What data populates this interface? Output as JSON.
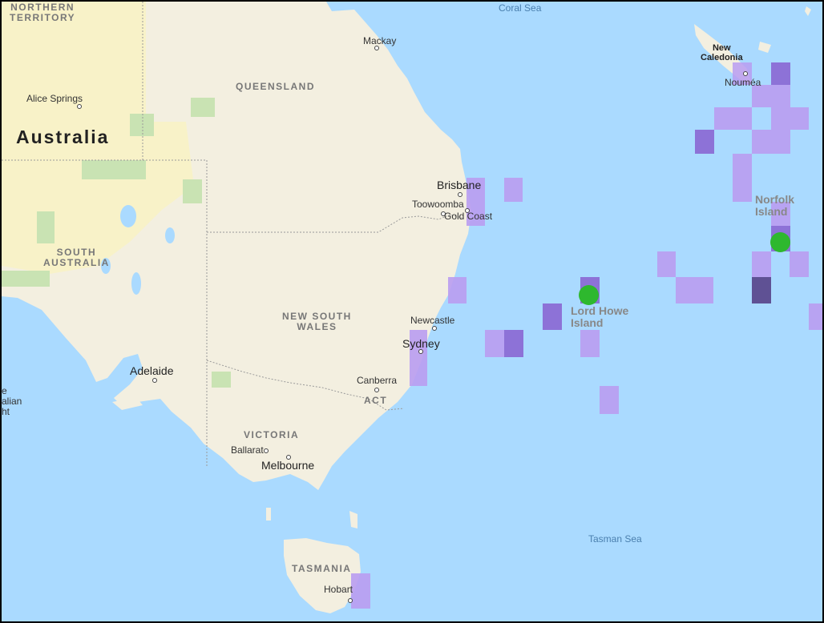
{
  "map": {
    "country_label": "Australia",
    "state_labels": {
      "northern_territory": [
        "NORTHERN",
        "TERRITORY"
      ],
      "queensland": "QUEENSLAND",
      "south_australia": [
        "SOUTH",
        "AUSTRALIA"
      ],
      "new_south_wales": [
        "NEW SOUTH",
        "WALES"
      ],
      "victoria": "VICTORIA",
      "act": "ACT",
      "tasmania": "TASMANIA"
    },
    "city_labels": {
      "alice_springs": "Alice Springs",
      "mackay": "Mackay",
      "brisbane": "Brisbane",
      "toowoomba": "Toowoomba",
      "gold_coast": "Gold Coast",
      "newcastle": "Newcastle",
      "sydney": "Sydney",
      "canberra": "Canberra",
      "adelaide": "Adelaide",
      "ballarat": "Ballarat",
      "melbourne": "Melbourne",
      "hobart": "Hobart",
      "noumea": "Nouméa"
    },
    "sea_labels": {
      "coral_sea": "Coral Sea",
      "tasman_sea": "Tasman Sea"
    },
    "island_labels": {
      "lord_howe": [
        "Lord Howe",
        "Island"
      ],
      "norfolk": [
        "Norfolk",
        "Island"
      ],
      "new_caledonia": [
        "New",
        "Caledonia"
      ]
    },
    "edge_fragment": [
      "e",
      "alian",
      "ht"
    ],
    "colors": {
      "ocean": "#aadaff",
      "land": "#f3efe0",
      "desert": "#f8f2c8",
      "park": "#c9e3b3",
      "cell_light": "#b99cf1",
      "cell_mid": "#8a66d3",
      "cell_dark": "#5b4a8e",
      "sighting_marker": "#2eb82e"
    },
    "markers": [
      "lord-howe-island-marker",
      "norfolk-island-marker"
    ]
  }
}
